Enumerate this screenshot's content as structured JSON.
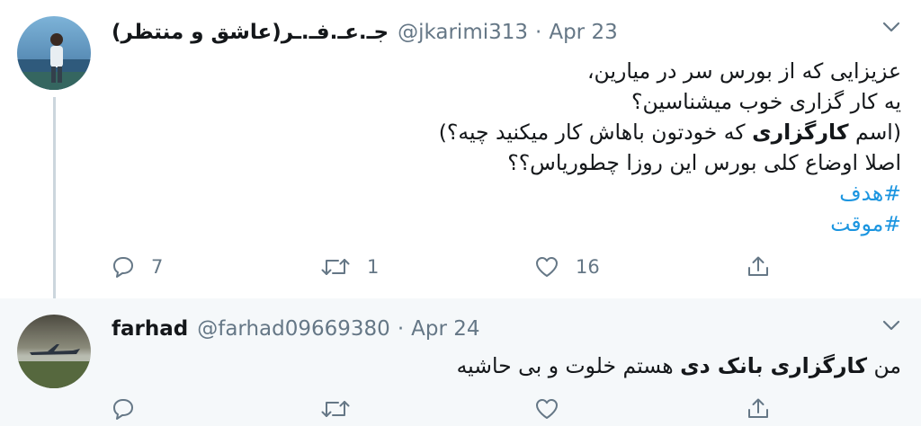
{
  "tweets": [
    {
      "display_name": "جـ.عـ.فـ.ـر(عاشق و منتظر)",
      "handle": "@jkarimi313",
      "separator": "·",
      "date": "Apr 23",
      "lines": {
        "l1": "عزیزایی که از بورس سر در میارین،",
        "l2": "یه کار گزاری خوب میشناسین؟",
        "l3_before": "(اسم ",
        "l3_bold": "کارگزاری",
        "l3_after": " که خودتون باهاش کار میکنید چیه؟)",
        "l4": "اصلا اوضاع کلی بورس این روزا چطوریاس؟؟"
      },
      "hashtags": [
        "#هدف",
        "#موقت"
      ],
      "reply_count": "7",
      "retweet_count": "1",
      "like_count": "16"
    },
    {
      "display_name": "farhad",
      "handle": "@farhad09669380",
      "separator": "·",
      "date": "Apr 24",
      "text": {
        "before": "من ",
        "bold": "کارگزاری بانک دی",
        "after": " هستم خلوت و بی حاشیه"
      }
    }
  ],
  "icons": {
    "reply": "reply-icon",
    "retweet": "retweet-icon",
    "like": "like-icon",
    "share": "share-icon",
    "chevron": "chevron-down-icon"
  },
  "colors": {
    "link": "#1b95e0",
    "secondary": "#657786",
    "reply_background": "#f5f8fa",
    "thread_line": "#ccd6dd"
  }
}
